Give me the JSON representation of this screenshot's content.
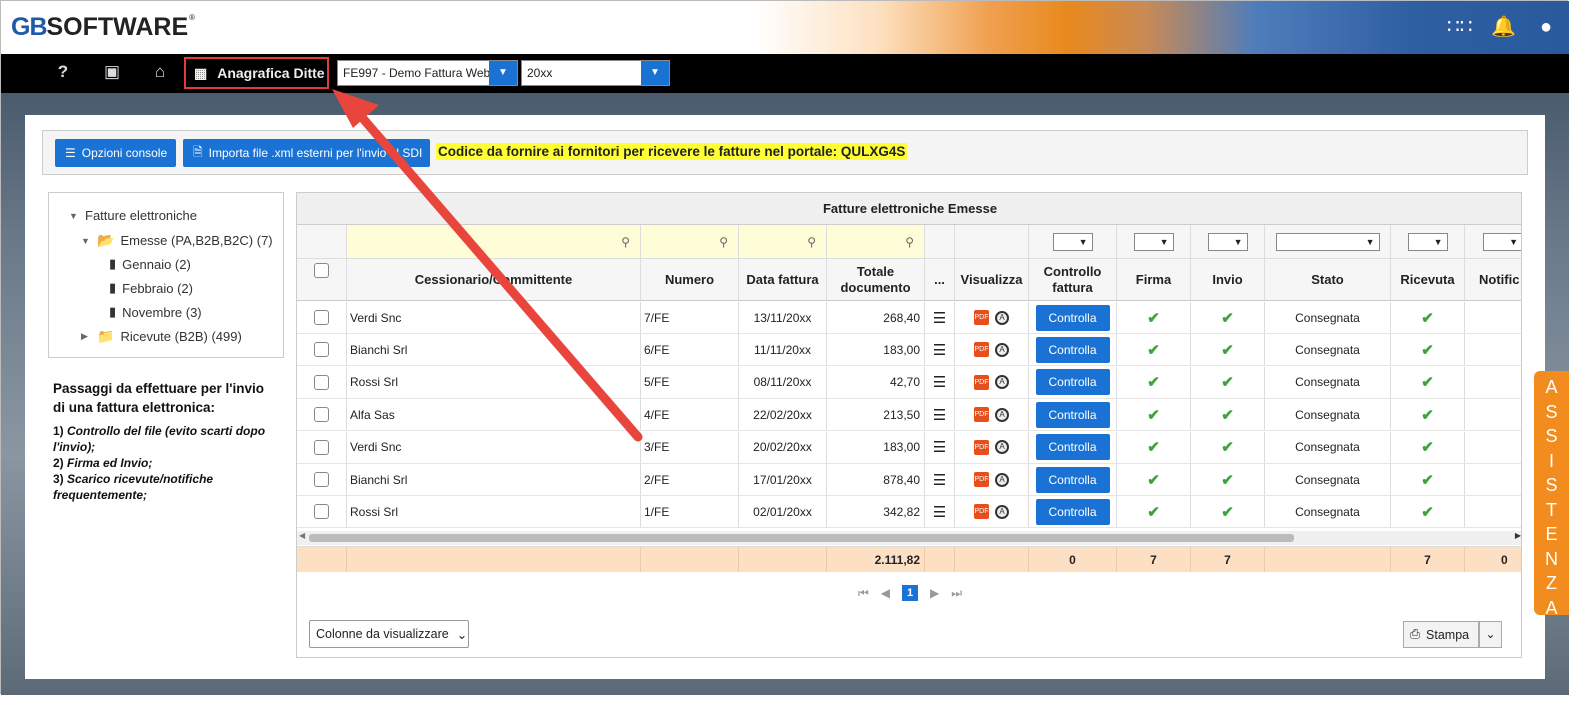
{
  "brand": {
    "prefix": "GB",
    "name": "SOFTWARE",
    "reg": "®"
  },
  "topbar_icons": [
    "apps-grid-icon",
    "bell-icon",
    "user-account-icon"
  ],
  "navbar": {
    "help_icon": "?",
    "anagrafica_label": "Anagrafica Ditte",
    "company_select": "FE997 - Demo Fattura Web",
    "year_select": "20xx"
  },
  "toolbar": {
    "opzioni_label": "Opzioni console",
    "importa_label": "Importa file .xml esterni per l'invio al SDI",
    "codice_text": "Codice da fornire ai fornitori per ricevere le fatture nel portale: QULXG4S"
  },
  "tree": {
    "root": "Fatture elettroniche",
    "emesse": "Emesse (PA,B2B,B2C) (7)",
    "months": [
      "Gennaio (2)",
      "Febbraio (2)",
      "Novembre (3)"
    ],
    "ricevute": "Ricevute (B2B) (499)"
  },
  "steps": {
    "title": "Passaggi da effettuare per l'invio di una fattura elettronica:",
    "items": [
      {
        "num": "1)",
        "text": "Controllo del file (evito scarti dopo l'invio);"
      },
      {
        "num": "2)",
        "text": "Firma ed Invio;"
      },
      {
        "num": "3)",
        "text": "Scarico ricevute/notifiche frequentemente;"
      }
    ]
  },
  "grid": {
    "title": "Fatture elettroniche Emesse",
    "columns": [
      "Cessionario/Committente",
      "Numero",
      "Data fattura",
      "Totale documento",
      "...",
      "Visualizza",
      "Controllo fattura",
      "Firma",
      "Invio",
      "Stato",
      "Ricevuta",
      "Notific"
    ],
    "rows": [
      {
        "cessionario": "Verdi Snc",
        "numero": "7/FE",
        "data": "13/11/20xx",
        "totale": "268,40",
        "controllo": "Controlla",
        "firma": "✔",
        "invio": "✔",
        "stato": "Consegnata",
        "ricevuta": "✔"
      },
      {
        "cessionario": "Bianchi Srl",
        "numero": "6/FE",
        "data": "11/11/20xx",
        "totale": "183,00",
        "controllo": "Controlla",
        "firma": "✔",
        "invio": "✔",
        "stato": "Consegnata",
        "ricevuta": "✔"
      },
      {
        "cessionario": "Rossi Srl",
        "numero": "5/FE",
        "data": "08/11/20xx",
        "totale": "42,70",
        "controllo": "Controlla",
        "firma": "✔",
        "invio": "✔",
        "stato": "Consegnata",
        "ricevuta": "✔"
      },
      {
        "cessionario": "Alfa Sas",
        "numero": "4/FE",
        "data": "22/02/20xx",
        "totale": "213,50",
        "controllo": "Controlla",
        "firma": "✔",
        "invio": "✔",
        "stato": "Consegnata",
        "ricevuta": "✔"
      },
      {
        "cessionario": "Verdi Snc",
        "numero": "3/FE",
        "data": "20/02/20xx",
        "totale": "183,00",
        "controllo": "Controlla",
        "firma": "✔",
        "invio": "✔",
        "stato": "Consegnata",
        "ricevuta": "✔"
      },
      {
        "cessionario": "Bianchi Srl",
        "numero": "2/FE",
        "data": "17/01/20xx",
        "totale": "878,40",
        "controllo": "Controlla",
        "firma": "✔",
        "invio": "✔",
        "stato": "Consegnata",
        "ricevuta": "✔"
      },
      {
        "cessionario": "Rossi Srl",
        "numero": "1/FE",
        "data": "02/01/20xx",
        "totale": "342,82",
        "controllo": "Controlla",
        "firma": "✔",
        "invio": "✔",
        "stato": "Consegnata",
        "ricevuta": "✔"
      }
    ],
    "totals": {
      "totale": "2.111,82",
      "controllo": "0",
      "firma": "7",
      "invio": "7",
      "ricevuta": "7",
      "notifiche": "0"
    },
    "page": "1",
    "colonne_label": "Colonne da visualizzare",
    "stampa_label": "Stampa"
  },
  "assistenza": [
    "A",
    "S",
    "S",
    "I",
    "S",
    "T",
    "E",
    "N",
    "Z",
    "A"
  ],
  "colors": {
    "accent": "#1a73d4",
    "highlight": "#ffff33",
    "arrow": "#e23a3a",
    "assist": "#f28c1e"
  }
}
